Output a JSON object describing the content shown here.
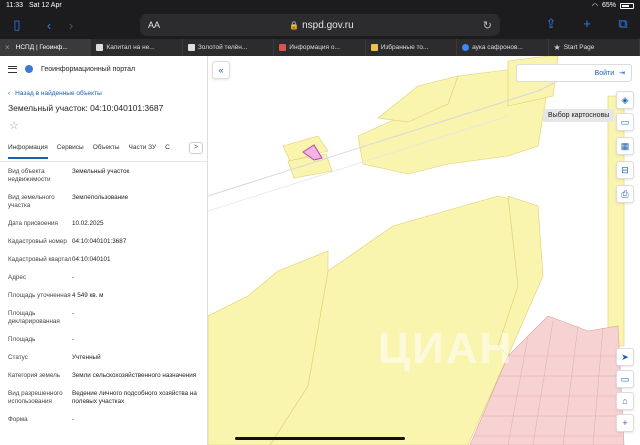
{
  "status": {
    "time": "11:33",
    "date": "Sat 12 Apr",
    "battery": "65%"
  },
  "browser": {
    "reader_label": "AA",
    "url": "nspd.gov.ru",
    "tabs": [
      {
        "label": "НСПД | Геоинф...",
        "active": true
      },
      {
        "label": "Капитал на не...",
        "active": false
      },
      {
        "label": "Золотой телён...",
        "active": false
      },
      {
        "label": "Информация о...",
        "active": false
      },
      {
        "label": "Избранные то...",
        "active": false
      },
      {
        "label": "аука сафронов...",
        "active": false
      },
      {
        "label": "Start Page",
        "active": false
      }
    ]
  },
  "portal": {
    "title": "Геоинформационный портал",
    "back_link": "Назад в найденные объекты",
    "object_title": "Земельный участок: 04:10:040101:3687",
    "tabs": [
      "Информация",
      "Сервисы",
      "Объекты",
      "Части ЗУ",
      "С"
    ],
    "more": ">",
    "properties": [
      {
        "key": "Вид объекта недвижимости",
        "value": "Земельный участок"
      },
      {
        "key": "Вид земельного участка",
        "value": "Землепользование"
      },
      {
        "key": "Дата присвоения",
        "value": "10.02.2025"
      },
      {
        "key": "Кадастровый номер",
        "value": "04:10:040101:3687"
      },
      {
        "key": "Кадастровый квартал",
        "value": "04:10:040101"
      },
      {
        "key": "Адрес",
        "value": "-"
      },
      {
        "key": "Площадь уточненная",
        "value": "4 549 кв. м"
      },
      {
        "key": "Площадь декларированная",
        "value": "-"
      },
      {
        "key": "Площадь",
        "value": "-"
      },
      {
        "key": "Статус",
        "value": "Учтенный"
      },
      {
        "key": "Категория земель",
        "value": "Земли сельскохозяйственного назначения"
      },
      {
        "key": "Вид разрешенного использования",
        "value": "Ведение личного подсобного хозяйства на полевых участках"
      },
      {
        "key": "Форма",
        "value": "-"
      }
    ]
  },
  "map": {
    "collapse": "«",
    "login_label": "Войти",
    "tooltip": "Выбор картосновы",
    "watermark": "ЦИАН",
    "colors": {
      "land": "#f9f4ae",
      "plot_border": "#e0cf6a",
      "highlight": "#e08ad0",
      "urban": "#f7d2d2"
    }
  }
}
